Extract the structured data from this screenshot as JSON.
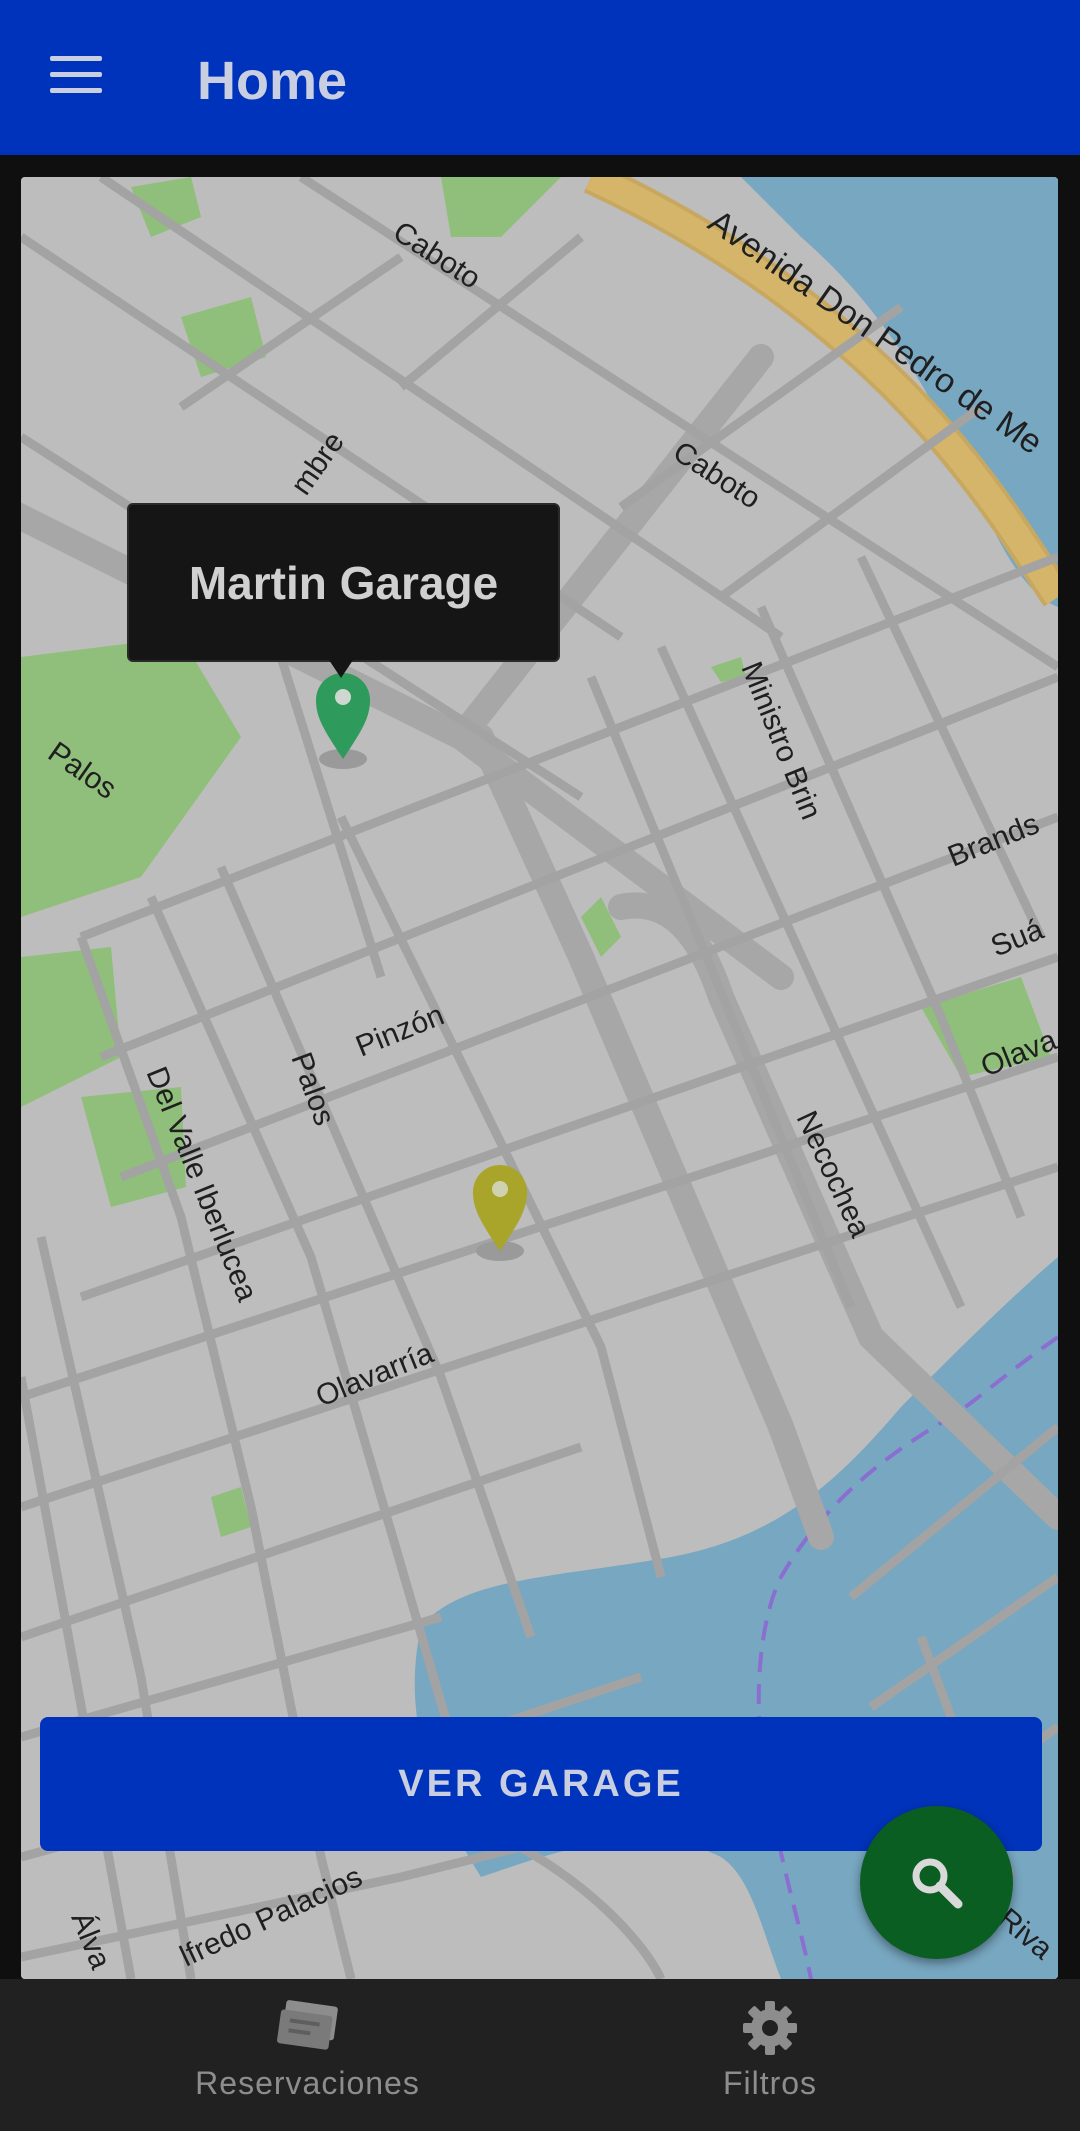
{
  "app_bar": {
    "title": "Home",
    "menu_icon": "hamburger-menu-icon"
  },
  "map": {
    "tooltip": "Martin Garage",
    "street_labels": {
      "caboto_top": "Caboto",
      "avenida": "Avenida Don Pedro de Me",
      "mbre": "mbre",
      "caboto_mid": "Caboto",
      "palos_left": "Palos",
      "ministro_brin": "Ministro Brin",
      "brandsen": "Brands",
      "suarez": "Suá",
      "olavarria_right": "Olava",
      "pinzon": "Pinzón",
      "palos_mid": "Palos",
      "del_valle": "Del Valle Iberlucea",
      "necochea": "Necochea",
      "olavarria": "Olavarría",
      "alvar": "Álva",
      "alfredo": "lfredo Palacios",
      "riva": "Riva"
    },
    "markers": [
      {
        "name": "Martin Garage",
        "color": "#2e9a5c",
        "selected": true
      },
      {
        "name": "",
        "color": "#a9a42a",
        "selected": false
      }
    ]
  },
  "actions": {
    "ver_garage": "VER GARAGE",
    "fab_icon": "search-icon"
  },
  "bottom_nav": {
    "items": [
      {
        "label": "Reservaciones",
        "icon": "tickets-icon"
      },
      {
        "label": "Filtros",
        "icon": "gear-icon"
      }
    ]
  },
  "colors": {
    "primary": "#0033bb",
    "fab": "#0a5e22",
    "nav_bg": "#212121"
  }
}
